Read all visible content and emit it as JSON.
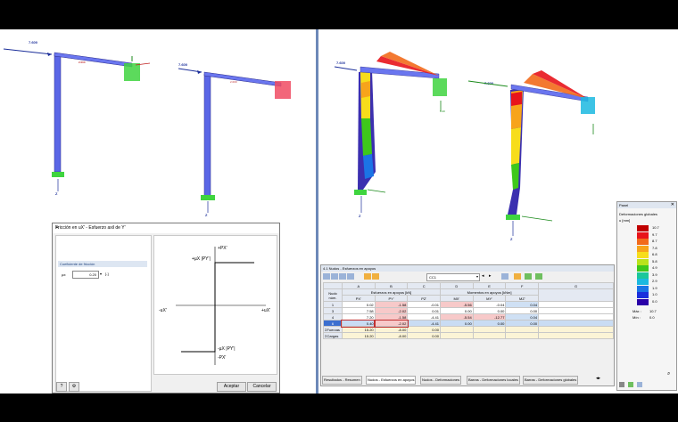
{
  "left_view": {
    "load_1": "7.600",
    "load_2": "7.600",
    "member_label": "2.000"
  },
  "right_view": {
    "load_1": "7.600",
    "load_2": "7.600",
    "member_label": "2.000"
  },
  "dialog": {
    "title": "Fricción en uX' - Esfuerzo axil de Y'",
    "section_label": "Coeficiente de fricción",
    "coef_label": "µx:",
    "coef_value": "0.20",
    "graph_labels": {
      "py": "+PX'",
      "mu_py": "+µX |PY'|",
      "neg_ux": "-uX'",
      "pos_ux": "+uX'",
      "neg_mu_py": "-µX |PY'|",
      "neg_py": "-PX'"
    },
    "ok_label": "Aceptar",
    "cancel_label": "Cancelar"
  },
  "table_window": {
    "title": "4.1 Nudos - Esfuerzos en apoyos",
    "load_case": "CC1",
    "col_letters": [
      "A",
      "B",
      "C",
      "D",
      "E",
      "F",
      "G"
    ],
    "group_header_1": "Esfuerzos en apoyos [kN]",
    "group_header_2": "Momentos en apoyos [kNm]",
    "row_header": "Nudo núm.",
    "sub_headers": [
      "PX'",
      "PY'",
      "PZ'",
      "MX'",
      "MY'",
      "MZ'"
    ],
    "rows": [
      {
        "node": "1",
        "px": "0.02",
        "py": "-1.58",
        "pz": "-0.01",
        "mx": "-5.56",
        "my": "-0.04",
        "mz": "0.04"
      },
      {
        "node": "3",
        "px": "7.58",
        "py": "-2.02",
        "pz": "0.01",
        "mx": "0.00",
        "my": "0.00",
        "mz": "0.00"
      },
      {
        "node": "4",
        "px": "7.20",
        "py": "-1.58",
        "pz": "-4.41",
        "mx": "-5.54",
        "my": "-12.77",
        "mz": "0.04"
      },
      {
        "node": "6",
        "px": "0.40",
        "py": "-2.02",
        "pz": "-4.41",
        "mx": "0.00",
        "my": "0.00",
        "mz": "0.00"
      },
      {
        "node": "ΣFuerzas",
        "px": "15.20",
        "py": "-8.00",
        "pz": "0.00",
        "mx": "",
        "my": "",
        "mz": ""
      },
      {
        "node": "ΣCargas",
        "px": "15.20",
        "py": "-8.00",
        "pz": "0.00",
        "mx": "",
        "my": "",
        "mz": ""
      }
    ],
    "tabs": [
      "Resultados - Resumen",
      "Nudos - Esfuerzos en apoyos",
      "Nudos - Deformaciones",
      "Barras - Deformaciones locales",
      "Barras - Deformaciones globales"
    ]
  },
  "legend": {
    "title": "Panel",
    "subtitle": "Deformaciones globales",
    "unit": "u [mm]",
    "values": [
      "10.7",
      "9.7",
      "8.7",
      "7.8",
      "6.8",
      "5.8",
      "4.9",
      "3.9",
      "2.9",
      "1.9",
      "1.0",
      "0.0"
    ],
    "colors": [
      "#c00000",
      "#e8141b",
      "#f26a1b",
      "#f7a41b",
      "#f7dd1b",
      "#b9e31b",
      "#3ec81b",
      "#1bc79a",
      "#1bb9e0",
      "#1b74e6",
      "#1b2fdc",
      "#2a00a8"
    ],
    "max_label": "Máx :",
    "max_value": "10.7",
    "min_label": "Mín :",
    "min_value": "0.0"
  }
}
